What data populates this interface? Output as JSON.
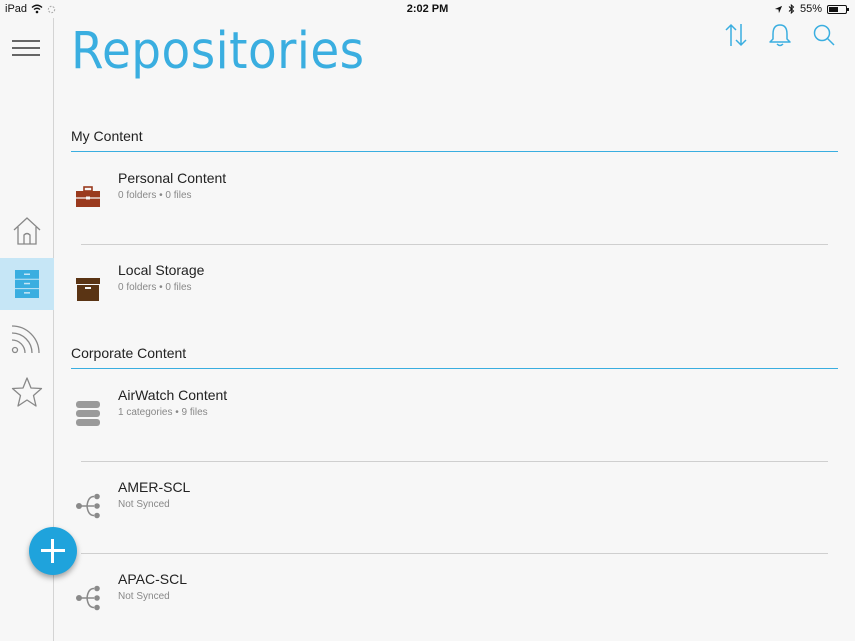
{
  "status_bar": {
    "device": "iPad",
    "time": "2:02 PM",
    "battery_percent": "55%"
  },
  "header": {
    "title": "Repositories"
  },
  "sections": {
    "my_content": {
      "title": "My Content",
      "items": [
        {
          "title": "Personal Content",
          "subtitle": "0 folders • 0 files",
          "icon": "briefcase-icon"
        },
        {
          "title": "Local Storage",
          "subtitle": "0 folders • 0 files",
          "icon": "storage-box-icon"
        }
      ]
    },
    "corporate_content": {
      "title": "Corporate Content",
      "items": [
        {
          "title": "AirWatch Content",
          "subtitle": "1 categories • 9 files",
          "icon": "database-icon"
        },
        {
          "title": "AMER-SCL",
          "subtitle": "Not Synced",
          "icon": "network-share-icon"
        },
        {
          "title": "APAC-SCL",
          "subtitle": "Not Synced",
          "icon": "network-share-icon"
        }
      ]
    }
  },
  "colors": {
    "accent": "#3aaee0",
    "fab": "#1fa3dc",
    "briefcase": "#9a3a1e",
    "storage_box": "#5a3414",
    "muted_icon": "#9a9a9a"
  }
}
